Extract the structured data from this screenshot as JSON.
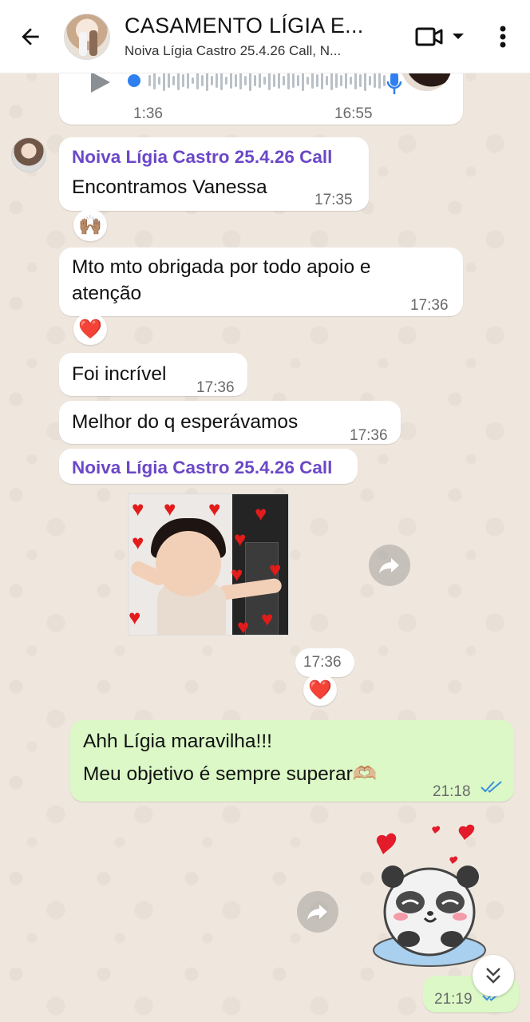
{
  "header": {
    "title": "CASAMENTO LÍGIA E...",
    "subtitle": "Noiva Lígia Castro 25.4.26 Call, N..."
  },
  "voice_message": {
    "current_time": "1:36",
    "sent_time": "16:55"
  },
  "messages": [
    {
      "sender": "Noiva Lígia Castro 25.4.26 Call",
      "text": "Encontramos Vanessa",
      "time": "17:35",
      "reaction": "🙌🏽"
    },
    {
      "text_line1": "Mto mto obrigada por todo apoio e",
      "text_line2": "atenção",
      "time": "17:36",
      "reaction": "❤️"
    },
    {
      "text": "Foi incrível",
      "time": "17:36"
    },
    {
      "text": "Melhor do q esperávamos",
      "time": "17:36"
    },
    {
      "sender": "Noiva Lígia Castro 25.4.26 Call",
      "time": "17:36",
      "reaction": "❤️"
    }
  ],
  "outgoing": [
    {
      "text_line1": "Ahh Lígia maravilha!!!",
      "text_line2": "Meu objetivo é sempre superar🫶🏼",
      "time": "21:18"
    },
    {
      "time": "21:19"
    }
  ],
  "icons": {
    "back": "back-arrow-icon",
    "video": "video-call-icon",
    "menu": "more-vert-icon",
    "forward": "forward-icon",
    "scroll": "scroll-down-icon",
    "play": "play-icon",
    "mic": "mic-icon"
  },
  "colors": {
    "sender_name": "#6b48c7",
    "outgoing_bubble": "#dbf8c6",
    "read_ticks": "#3b8fe0",
    "wallpaper": "#efe7de"
  }
}
